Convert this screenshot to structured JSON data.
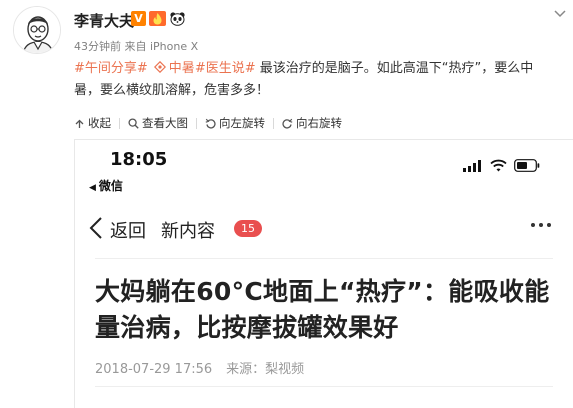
{
  "post": {
    "author": "李青大夫",
    "time": "43分钟前",
    "source": "来自 iPhone X",
    "topic_1": "#午间分享#",
    "location": "中暑",
    "topic_2": "#医生说#",
    "text_line_1_tail": " 最该治疗的是脑子。如此高温下“热疗”，要么中",
    "text_line_2": "暑，要么横纹肌溶解，危害多多！",
    "badge_v": "V"
  },
  "actions": {
    "collapse": "收起",
    "view_large": "查看大图",
    "rotate_left": "向左旋转",
    "rotate_right": "向右旋转"
  },
  "phone": {
    "time": "18:05",
    "back_app": "微信",
    "back_arrow": "◀",
    "nav_back": "返回",
    "nav_title": "新内容",
    "unread_count": "15",
    "headline": "大妈躺在60°C地面上“热疗”：能吸收能量治病，比按摩拔罐效果好",
    "date": "2018-07-29 17:56",
    "source": "来源：梨视频"
  },
  "colors": {
    "topic": "#eb7350",
    "badge_v": "#ff8200",
    "unread_badge": "#e94f4f"
  },
  "icons": [
    "avatar-cartoon",
    "verified-v-icon",
    "fire-icon",
    "panda-icon",
    "chevron-down-icon",
    "location-icon",
    "collapse-icon",
    "search-icon",
    "rotate-left-icon",
    "rotate-right-icon",
    "signal-icon",
    "wifi-icon",
    "battery-icon",
    "back-chevron-icon",
    "more-icon"
  ]
}
